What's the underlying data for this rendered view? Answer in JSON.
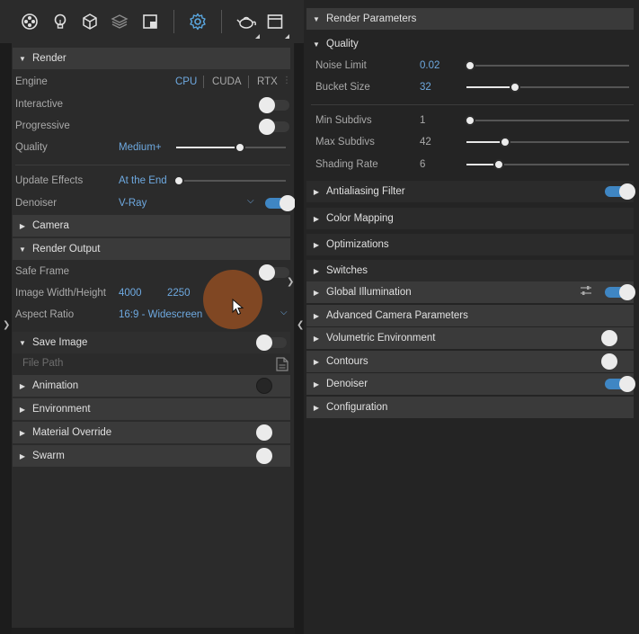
{
  "toolbar": {
    "icons": [
      "render-elements-icon",
      "light-bulb-icon",
      "cube-icon",
      "layers-icon",
      "frame-icon",
      "settings-gear-icon",
      "teapot-render-icon",
      "frame-buffer-window-icon"
    ]
  },
  "left": {
    "render": {
      "header": "Render",
      "engine": {
        "label": "Engine",
        "options": [
          "CPU",
          "CUDA",
          "RTX"
        ],
        "selected": "CPU"
      },
      "interactive": {
        "label": "Interactive",
        "on": false
      },
      "progressive": {
        "label": "Progressive",
        "on": false
      },
      "quality": {
        "label": "Quality",
        "value": "Medium+",
        "level": 0.58
      },
      "update_effects": {
        "label": "Update Effects",
        "value": "At the End",
        "level": 0.0
      },
      "denoiser": {
        "label": "Denoiser",
        "value": "V-Ray",
        "on": true
      }
    },
    "camera": {
      "header": "Camera"
    },
    "render_output": {
      "header": "Render Output",
      "safe_frame": {
        "label": "Safe Frame",
        "on": false
      },
      "image_size": {
        "label": "Image Width/Height",
        "width": "4000",
        "height": "2250"
      },
      "aspect_ratio": {
        "label": "Aspect Ratio",
        "value": "16:9 - Widescreen"
      }
    },
    "save_image": {
      "header": "Save Image",
      "on": false,
      "file_path_label": "File Path"
    },
    "animation": {
      "header": "Animation"
    },
    "environment": {
      "header": "Environment"
    },
    "material_override": {
      "header": "Material Override"
    },
    "swarm": {
      "header": "Swarm"
    }
  },
  "right": {
    "render_parameters": {
      "header": "Render Parameters"
    },
    "quality": {
      "header": "Quality",
      "noise_limit": {
        "label": "Noise Limit",
        "value": "0.02",
        "level": 0.02
      },
      "bucket_size": {
        "label": "Bucket Size",
        "value": "32",
        "level": 0.3
      },
      "min_subdivs": {
        "label": "Min Subdivs",
        "value": "1",
        "level": 0.02
      },
      "max_subdivs": {
        "label": "Max Subdivs",
        "value": "42",
        "level": 0.24
      },
      "shading_rate": {
        "label": "Shading Rate",
        "value": "6",
        "level": 0.2
      }
    },
    "sections": [
      {
        "label": "Antialiasing Filter"
      },
      {
        "label": "Color Mapping"
      },
      {
        "label": "Optimizations"
      },
      {
        "label": "Switches"
      },
      {
        "label": "Global Illumination"
      },
      {
        "label": "Advanced Camera Parameters"
      },
      {
        "label": "Volumetric Environment"
      },
      {
        "label": "Contours"
      },
      {
        "label": "Denoiser"
      },
      {
        "label": "Configuration"
      }
    ]
  },
  "colors": {
    "accent": "#6ea9e0",
    "toggle_on": "#3f86c3",
    "cursor_halo": "#8a4a22"
  }
}
